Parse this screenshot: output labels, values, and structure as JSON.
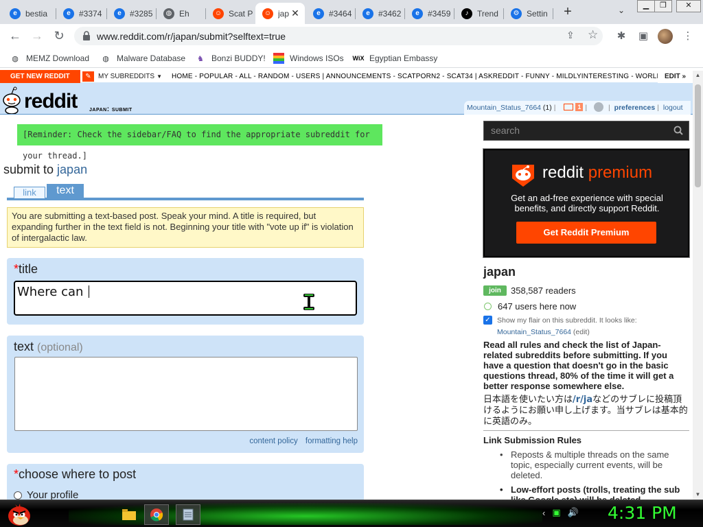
{
  "browser": {
    "tabs": [
      {
        "title": "bestia",
        "icon": "edge-icon",
        "active": false
      },
      {
        "title": "#3374",
        "icon": "edge-icon",
        "active": false
      },
      {
        "title": "#3285",
        "icon": "edge-icon",
        "active": false
      },
      {
        "title": "Eh",
        "icon": "globe-icon",
        "active": false
      },
      {
        "title": "Scat P",
        "icon": "reddit-icon",
        "active": false
      },
      {
        "title": "jap",
        "icon": "reddit-icon",
        "active": true
      },
      {
        "title": "#3464",
        "icon": "edge-icon",
        "active": false
      },
      {
        "title": "#3462",
        "icon": "edge-icon",
        "active": false
      },
      {
        "title": "#3459",
        "icon": "edge-icon",
        "active": false
      },
      {
        "title": "Trend",
        "icon": "tiktok-icon",
        "active": false
      },
      {
        "title": "Settin",
        "icon": "gear-icon",
        "active": false
      }
    ],
    "new_tab": "+",
    "tab_search": "⌄",
    "url": "www.reddit.com/r/japan/submit?selftext=true",
    "bookmarks": [
      {
        "label": "MEMZ Download",
        "icon": "globe-icon"
      },
      {
        "label": "Malware Database",
        "icon": "globe-icon"
      },
      {
        "label": "Bonzi BUDDY!",
        "icon": "bonzi-icon"
      },
      {
        "label": "Windows ISOs",
        "icon": "windows-flag-icon"
      },
      {
        "label": "Egyptian Embassy",
        "icon": "wix-icon"
      }
    ]
  },
  "reddit": {
    "get_new": "GET NEW REDDIT",
    "my_subreddits": "MY SUBREDDITS",
    "sr_links": "HOME - POPULAR - ALL - RANDOM - USERS  |  ANNOUNCEMENTS - SCATPORN2 - SCAT34  |  ASKREDDIT - FUNNY - MILDLYINTERESTING - WORLDNEWS",
    "edit": "EDIT »",
    "wordmark": "reddit",
    "page_name": "japan: submit",
    "user": {
      "name": "Mountain_Status_7664",
      "karma": "(1)",
      "mail_count": "1",
      "preferences": "preferences",
      "logout": "logout"
    }
  },
  "submit": {
    "reminder": "[Reminder: Check the sidebar/FAQ to find the appropriate subreddit for your thread.]",
    "submit_to": "submit to",
    "subreddit": "japan",
    "tab_link": "link",
    "tab_text": "text",
    "info": "You are submitting a text-based post. Speak your mind. A title is required, but expanding further in the text field is not. Beginning your title with \"vote up if\" is violation of intergalactic law.",
    "title_label": "title",
    "title_value": "Where can ",
    "text_label": "text",
    "text_optional": "(optional)",
    "content_policy": "content policy",
    "formatting_help": "formatting help",
    "choose_label": "choose where to post",
    "your_profile": "Your profile"
  },
  "sidebar": {
    "search_placeholder": "search",
    "premium": {
      "word1": "reddit",
      "word2": "premium",
      "desc": "Get an ad-free experience with special benefits, and directly support Reddit.",
      "button": "Get Reddit Premium"
    },
    "sr_name": "japan",
    "join": "join",
    "readers": "358,587 readers",
    "online": "647 users here now",
    "flair_text": "Show my flair on this subreddit. It looks like:",
    "flair_user": "Mountain_Status_7664",
    "flair_edit": "(edit)",
    "rules_text": "Read all rules and check the list of Japan-related subreddits before submitting. If you have a question that doesn't go in the basic questions thread, 80% of the time it will get a better response somewhere else.",
    "jp_before": "日本語を使いたい方は",
    "jp_link": "/r/ja",
    "jp_after": "などのサブレに投稿頂けるようにお願い申し上げます。当サブレは基本的に英語のみ。",
    "lsr_title": "Link Submission Rules",
    "lsr_item1": "Reposts & multiple threads on the same topic, especially current events, will be deleted.",
    "lsr_item2": "Low-effort posts (trolls, treating the sub like Google etc) will be deleted."
  },
  "taskbar": {
    "clock": "4:31 PM"
  },
  "colors": {
    "reddit_orange": "#ff4500",
    "header_blue": "#cee3f8",
    "link_blue": "#336699",
    "reminder_green": "#5ee65e",
    "clock_green": "#33ff33"
  }
}
